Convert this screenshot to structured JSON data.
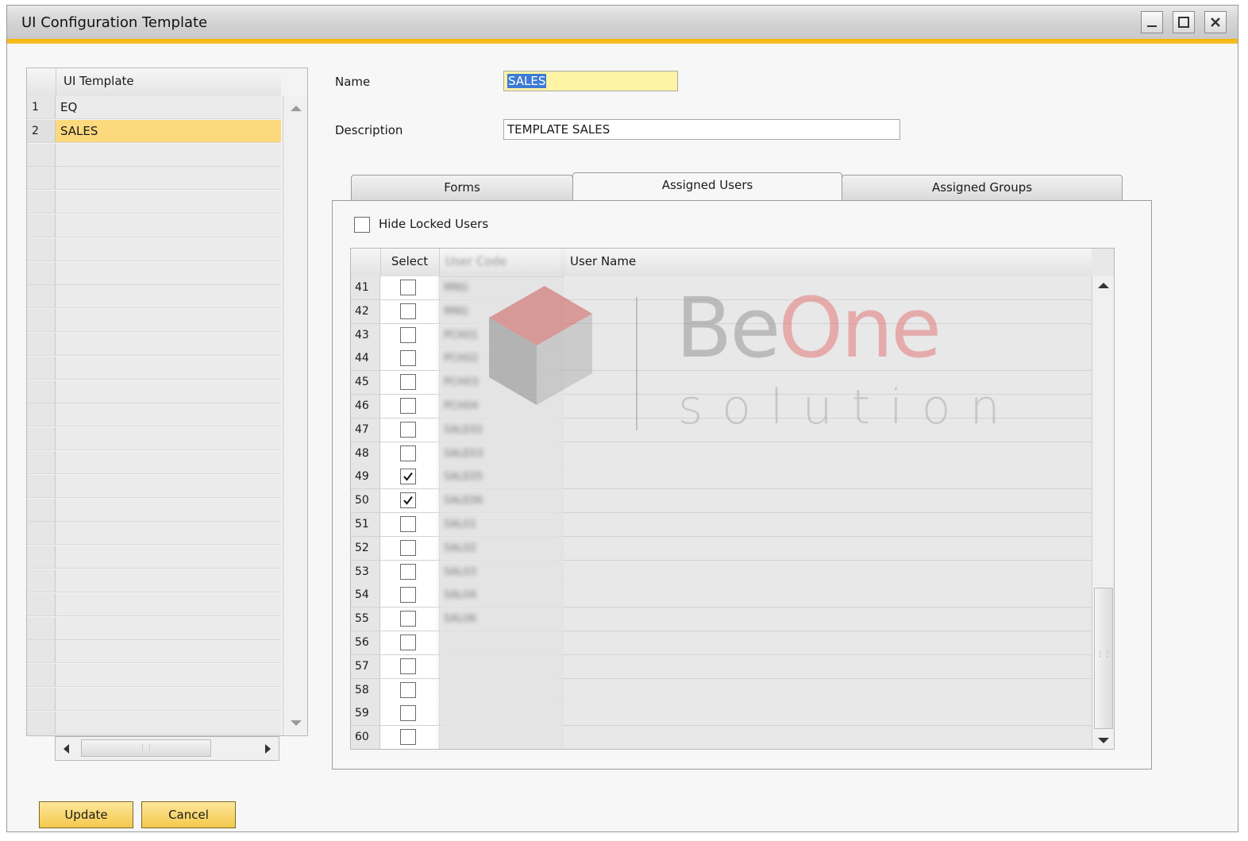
{
  "window": {
    "title": "UI Configuration Template"
  },
  "templates": {
    "header": "UI Template",
    "rows": [
      {
        "num": "1",
        "name": "EQ"
      },
      {
        "num": "2",
        "name": "SALES"
      }
    ],
    "selected_index": 1
  },
  "form": {
    "name_label": "Name",
    "name_value": "SALES",
    "description_label": "Description",
    "description_value": "TEMPLATE SALES"
  },
  "tabs": [
    {
      "label": "Forms",
      "active": false
    },
    {
      "label": "Assigned Users",
      "active": true
    },
    {
      "label": "Assigned Groups",
      "active": false
    }
  ],
  "assigned_users": {
    "hide_locked_label": "Hide Locked Users",
    "hide_locked_checked": false,
    "columns": {
      "select": "Select",
      "user_code": "User Code",
      "user_name": "User Name"
    },
    "rows": [
      {
        "num": "41",
        "checked": false,
        "code": "MNG"
      },
      {
        "num": "42",
        "checked": false,
        "code": "MNG"
      },
      {
        "num": "43",
        "checked": false,
        "code": "PCH01"
      },
      {
        "num": "44",
        "checked": false,
        "code": "PCH02"
      },
      {
        "num": "45",
        "checked": false,
        "code": "PCH03"
      },
      {
        "num": "46",
        "checked": false,
        "code": "PCH04"
      },
      {
        "num": "47",
        "checked": false,
        "code": "SALE02"
      },
      {
        "num": "48",
        "checked": false,
        "code": "SALE03"
      },
      {
        "num": "49",
        "checked": true,
        "code": "SALE05"
      },
      {
        "num": "50",
        "checked": true,
        "code": "SALE06"
      },
      {
        "num": "51",
        "checked": false,
        "code": "SAL01"
      },
      {
        "num": "52",
        "checked": false,
        "code": "SAL02"
      },
      {
        "num": "53",
        "checked": false,
        "code": "SAL03"
      },
      {
        "num": "54",
        "checked": false,
        "code": "SAL04"
      },
      {
        "num": "55",
        "checked": false,
        "code": "SAL06"
      },
      {
        "num": "56",
        "checked": false,
        "code": ""
      },
      {
        "num": "57",
        "checked": false,
        "code": ""
      },
      {
        "num": "58",
        "checked": false,
        "code": ""
      },
      {
        "num": "59",
        "checked": false,
        "code": ""
      },
      {
        "num": "60",
        "checked": false,
        "code": ""
      }
    ]
  },
  "watermark": {
    "brand_a": "Be",
    "brand_b": "One",
    "brand_c": "solution"
  },
  "buttons": {
    "update": "Update",
    "cancel": "Cancel"
  },
  "colors": {
    "accent": "#f5b400",
    "selected_row": "#fcd97d",
    "name_field": "#fff3a6"
  }
}
